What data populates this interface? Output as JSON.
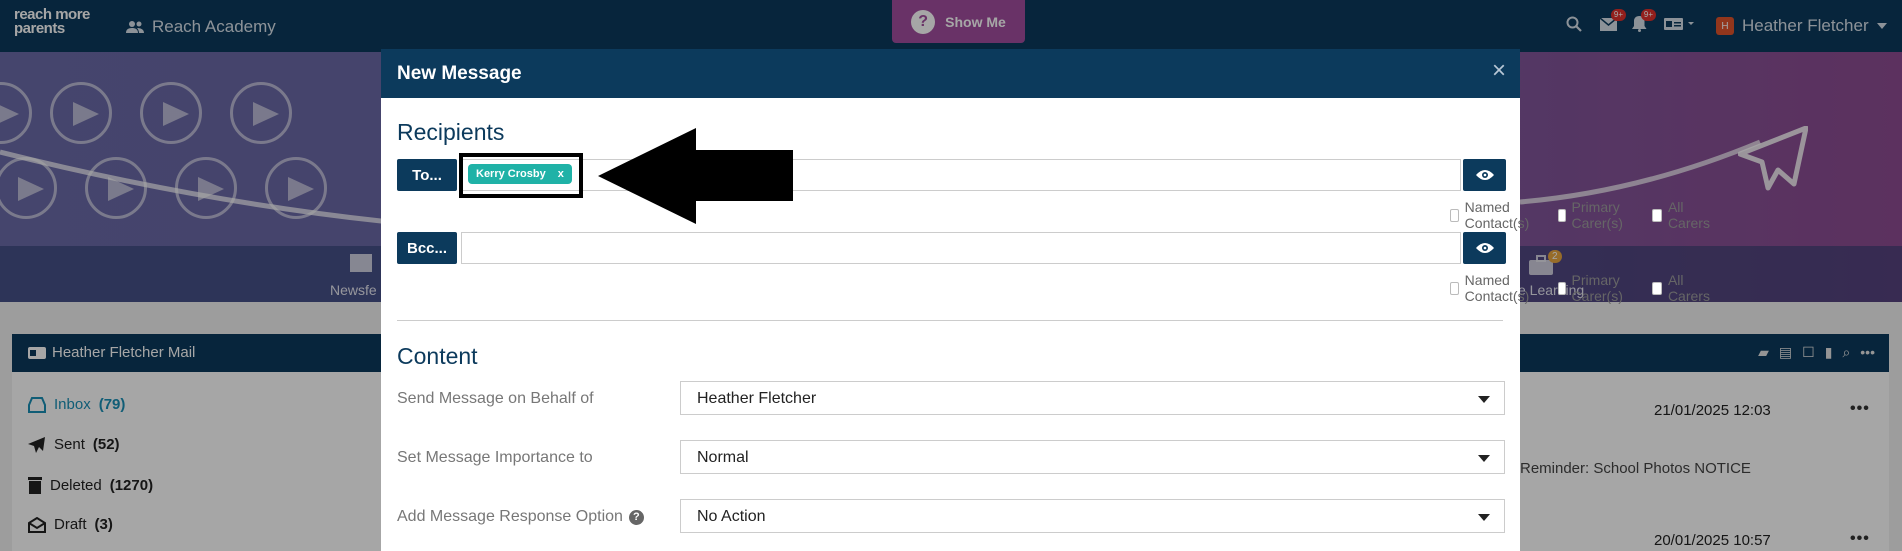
{
  "app": {
    "logo_line1": "reach more",
    "logo_line2": "parents",
    "school_name": "Reach Academy",
    "show_me_label": "Show Me",
    "notifications_badge": "9+",
    "alerts_badge": "9+",
    "user_name": "Heather Fletcher",
    "user_initial": "H"
  },
  "banner": {
    "nav_left_label": "Newsfe",
    "nav_right_label": "e Learning",
    "nav_right_badge": "2"
  },
  "mail": {
    "title": "Heather Fletcher Mail",
    "folders": [
      {
        "label": "Inbox",
        "count": "(79)"
      },
      {
        "label": "Sent",
        "count": "(52)"
      },
      {
        "label": "Deleted",
        "count": "(1270)"
      },
      {
        "label": "Draft",
        "count": "(3)"
      }
    ],
    "messages": [
      {
        "date": "21/01/2025 12:03",
        "subject": ""
      },
      {
        "date": "",
        "subject": "Reminder: School Photos NOTICE"
      },
      {
        "date": "20/01/2025 10:57",
        "subject": ""
      }
    ],
    "row_menu": "•••"
  },
  "modal": {
    "title": "New Message",
    "close_glyph": "×",
    "recipients_heading": "Recipients",
    "to_button": "To...",
    "bcc_button": "Bcc...",
    "to_chip": {
      "name": "Kerry Crosby",
      "remove": "x"
    },
    "checkboxes": [
      "Named Contact(s)",
      "Primary Carer(s)",
      "All Carers"
    ],
    "content_heading": "Content",
    "fields": [
      {
        "label": "Send Message on Behalf of",
        "value": "Heather Fletcher"
      },
      {
        "label": "Set Message Importance to",
        "value": "Normal"
      },
      {
        "label": "Add Message Response Option",
        "value": "No Action",
        "help": "?"
      }
    ]
  },
  "colors": {
    "navy": "#0c3a5c",
    "show_me": "#a24e9e",
    "chip": "#1fb2a7",
    "badge_red": "#e0302b"
  },
  "icons": [
    "users-icon",
    "question-icon",
    "search-icon",
    "mail-icon",
    "bell-icon",
    "id-card-icon",
    "eye-icon",
    "inbox-icon",
    "paper-plane-icon",
    "trash-icon",
    "envelope-open-icon",
    "mail-header-icon",
    "close-icon",
    "caret-down-icon"
  ]
}
